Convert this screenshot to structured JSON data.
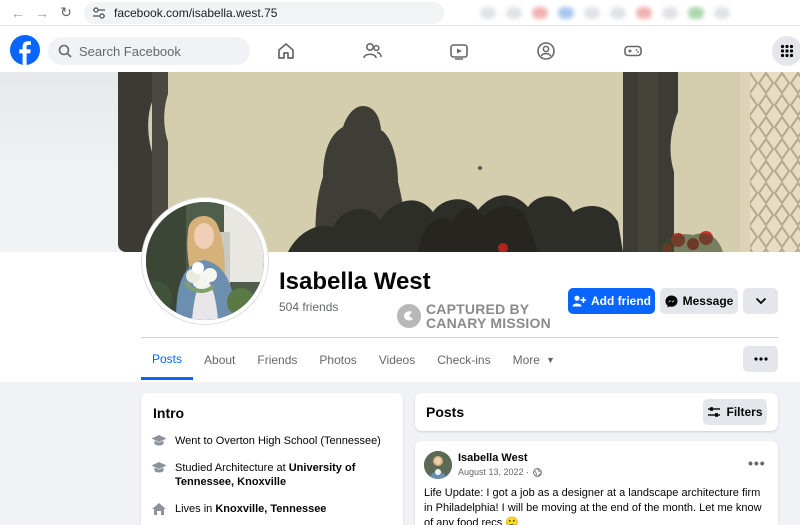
{
  "browser": {
    "url": "facebook.com/isabella.west.75"
  },
  "header": {
    "search_placeholder": "Search Facebook",
    "nav_icons": [
      "home-icon",
      "friends-icon",
      "watch-icon",
      "groups-icon",
      "gaming-icon"
    ],
    "menu_icon": "grid-menu-icon"
  },
  "profile": {
    "name": "Isabella West",
    "friends": "504 friends",
    "add_friend_label": "Add friend",
    "message_label": "Message"
  },
  "watermark": {
    "line1": "CAPTURED BY",
    "line2": "CANARY MISSION"
  },
  "tabs": [
    {
      "label": "Posts",
      "active": true
    },
    {
      "label": "About"
    },
    {
      "label": "Friends"
    },
    {
      "label": "Photos"
    },
    {
      "label": "Videos"
    },
    {
      "label": "Check-ins"
    },
    {
      "label": "More"
    }
  ],
  "intro": {
    "title": "Intro",
    "items": [
      {
        "icon": "graduation-cap-icon",
        "text": "Went to Overton High School (Tennessee)",
        "bold": ""
      },
      {
        "icon": "graduation-cap-icon",
        "text": "Studied Architecture at ",
        "bold": "University of Tennessee, Knoxville"
      },
      {
        "icon": "house-icon",
        "text": "Lives in ",
        "bold": "Knoxville, Tennessee"
      }
    ]
  },
  "posts": {
    "title": "Posts",
    "filters_label": "Filters",
    "items": [
      {
        "author": "Isabella West",
        "date": "August 13, 2022 ·",
        "text": "Life Update: I got a job as a designer at a landscape architecture firm in Philadelphia! I will be moving at the end of the month. Let me know of any food recs 🙂"
      }
    ]
  },
  "colors": {
    "brand": "#0866ff",
    "secondary_button": "#e4e6eb",
    "page_bg": "#f0f2f5"
  }
}
